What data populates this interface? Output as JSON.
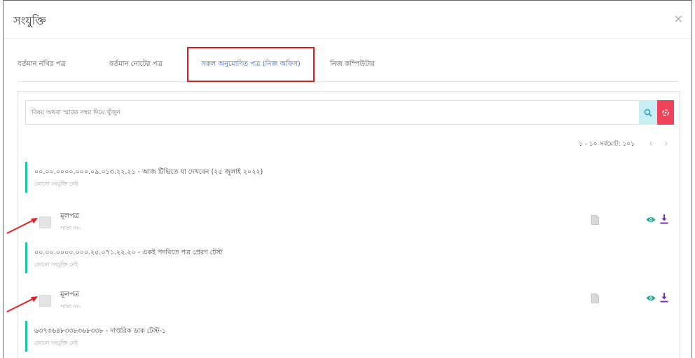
{
  "modal": {
    "title": "সংযুক্তি",
    "close_symbol": "×"
  },
  "tabs": [
    {
      "label": "বর্তমান নথির পত্র"
    },
    {
      "label": "বর্তমান নোটের পত্র"
    },
    {
      "label": "সকল অনুমোদিত পত্র (নিজ অফিস)",
      "active": true
    },
    {
      "label": "নিজ কম্পিউটার"
    }
  ],
  "search": {
    "placeholder": "বিষয় অথবা স্মারক নম্বর দিয়ে খুঁজুন",
    "search_icon": "search-icon",
    "reset_icon": "reset-icon"
  },
  "pagination": {
    "range": "১ - ১০ সর্বমোট: ১০১",
    "prev": "‹",
    "next": "›"
  },
  "groups": [
    {
      "title": "০০.০০.০০০০.০০০.০৯.০১৩.২২.২১ - আজ টিভিতে যা দেখবেন (২৫ জুলাই ২০২২)",
      "subtitle": "কোনো সংযুক্তি নেই",
      "item": {
        "label": "মূলপত্র",
        "sub": "পাতা নং-"
      }
    },
    {
      "title": "০০.০০.০০০০.০০০.২৫.০৭১.২২.২০ - একই পদবিতে পত্র প্রেরণ টেস্ট",
      "subtitle": "কোনো সংযুক্তি নেই",
      "item": {
        "label": "মূলপত্র",
        "sub": "পাতা নং-"
      }
    },
    {
      "title": "৬৩৭৩৬৪৮৩৩৮৩৬৮৩৩৮ - দাপ্তরিক ডাক টেস্ট-১",
      "subtitle": "কোনো সংযুক্তি নেই"
    }
  ],
  "colors": {
    "accent_teal": "#1cc4a9",
    "active_tab_text": "#3a64d6",
    "highlight_box": "#d71f26",
    "reset_button": "#f0435a",
    "search_button": "#c8eef3",
    "download_icon": "#7b2bb5",
    "eye_icon": "#1aa88f",
    "arrow": "#e22222"
  }
}
